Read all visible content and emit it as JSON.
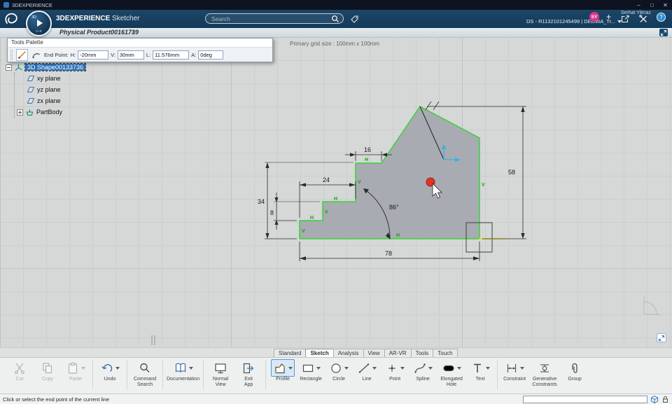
{
  "titlebar": {
    "title": "3DEXPERIENCE",
    "minimize": "–",
    "maximize": "□",
    "close": "✕"
  },
  "topbar": {
    "brand": "3DEXPERIENCE",
    "app_name": "Sketcher",
    "search_placeholder": "Search",
    "user_name": "Serhat Yilmaz",
    "tenant": "DS - R1132101245499 | DELMIA_Tr...",
    "avatar_initials": "SY",
    "add_label": "+",
    "help_label": "?"
  },
  "tabbar": {
    "product_tab": "Physical Product00161739",
    "new_tab": "+"
  },
  "tools_palette": {
    "title": "Tools Palette",
    "end_point_label": "End Point:",
    "fields": [
      {
        "label": "H:",
        "value": "-20mm"
      },
      {
        "label": "V:",
        "value": "30mm"
      },
      {
        "label": "L:",
        "value": "11.576mm"
      },
      {
        "label": "A:",
        "value": "0deg"
      }
    ]
  },
  "tree": {
    "items": [
      {
        "label": "3D Shape00133736",
        "selected": true
      },
      {
        "label": "xy plane"
      },
      {
        "label": "yz plane"
      },
      {
        "label": "zx plane"
      },
      {
        "label": "PartBody"
      }
    ]
  },
  "canvas": {
    "grid_label": "Primary grid size : 100mm x 100mm"
  },
  "sketch": {
    "dims": {
      "top_width": "16",
      "left_width": "24",
      "left_height": "34",
      "step_height": "8",
      "right_height": "58",
      "bottom_width": "78",
      "angle": "86°"
    },
    "constraints": [
      "V",
      "H",
      "V",
      "H",
      "V",
      "H",
      "H",
      "V"
    ]
  },
  "bottom_tabs": [
    {
      "label": "Standard"
    },
    {
      "label": "Sketch",
      "selected": true
    },
    {
      "label": "Analysis"
    },
    {
      "label": "View"
    },
    {
      "label": "AR-VR"
    },
    {
      "label": "Tools"
    },
    {
      "label": "Touch"
    }
  ],
  "toolbar": {
    "items": [
      {
        "label": "Cut"
      },
      {
        "label": "Copy"
      },
      {
        "label": "Paste"
      },
      {
        "label": "Undo"
      },
      {
        "label": "Command Search"
      },
      {
        "label": "Documentation"
      },
      {
        "label": "Normal View"
      },
      {
        "label": "Exit App"
      },
      {
        "label": "Profile"
      },
      {
        "label": "Rectangle"
      },
      {
        "label": "Circle"
      },
      {
        "label": "Line"
      },
      {
        "label": "Point"
      },
      {
        "label": "Spline"
      },
      {
        "label": "Elongated Hole"
      },
      {
        "label": "Text"
      },
      {
        "label": "Constraint"
      },
      {
        "label": "Generative Constraints"
      },
      {
        "label": "Group"
      }
    ]
  },
  "statusbar": {
    "message": "Click or select the end point of the current line"
  }
}
